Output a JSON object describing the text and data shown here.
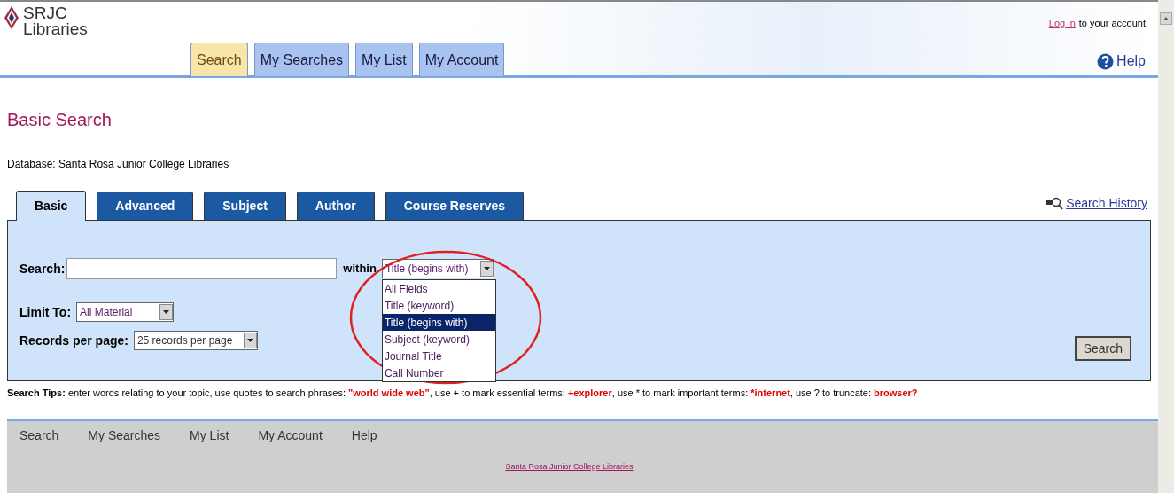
{
  "header": {
    "logo_line1": "SRJC",
    "logo_line2": "Libraries",
    "login_link": "Log in",
    "login_rest": "to your account",
    "help": "Help",
    "tabs": [
      {
        "label": "Search",
        "selected": true
      },
      {
        "label": "My Searches",
        "selected": false
      },
      {
        "label": "My List",
        "selected": false
      },
      {
        "label": "My Account",
        "selected": false
      }
    ]
  },
  "page_title": "Basic Search",
  "database": "Database: Santa Rosa Junior College Libraries",
  "search_tabs": [
    {
      "label": "Basic",
      "selected": true
    },
    {
      "label": "Advanced",
      "selected": false
    },
    {
      "label": "Subject",
      "selected": false
    },
    {
      "label": "Author",
      "selected": false
    },
    {
      "label": "Course Reserves",
      "selected": false
    }
  ],
  "search_history": "Search History",
  "form": {
    "search_label": "Search:",
    "within_label": "within",
    "within_value": "Title (begins with)",
    "within_options": [
      {
        "label": "All Fields",
        "selected": false
      },
      {
        "label": "Title (keyword)",
        "selected": false
      },
      {
        "label": "Title (begins with)",
        "selected": true
      },
      {
        "label": "Subject (keyword)",
        "selected": false
      },
      {
        "label": "Journal Title",
        "selected": false
      },
      {
        "label": "Call Number",
        "selected": false
      }
    ],
    "limit_label": "Limit To:",
    "limit_value": "All Material",
    "records_label": "Records per page:",
    "records_value": "25 records per page",
    "search_button": "Search"
  },
  "tips": [
    {
      "kind": "label",
      "text": "Search Tips:"
    },
    {
      "kind": "plain",
      "text": " enter words relating to your topic, use quotes to search phrases: "
    },
    {
      "kind": "example",
      "text": "\"world wide web\""
    },
    {
      "kind": "plain",
      "text": ", use + to mark essential terms: "
    },
    {
      "kind": "example",
      "text": "+explorer"
    },
    {
      "kind": "plain",
      "text": ", use * to mark important terms: "
    },
    {
      "kind": "example",
      "text": "*internet"
    },
    {
      "kind": "plain",
      "text": ", use ? to truncate: "
    },
    {
      "kind": "example",
      "text": "browser?"
    }
  ],
  "footer": {
    "links": [
      "Search",
      "My Searches",
      "My List",
      "My Account",
      "Help"
    ],
    "college_link": "Santa Rosa Junior College Libraries"
  }
}
